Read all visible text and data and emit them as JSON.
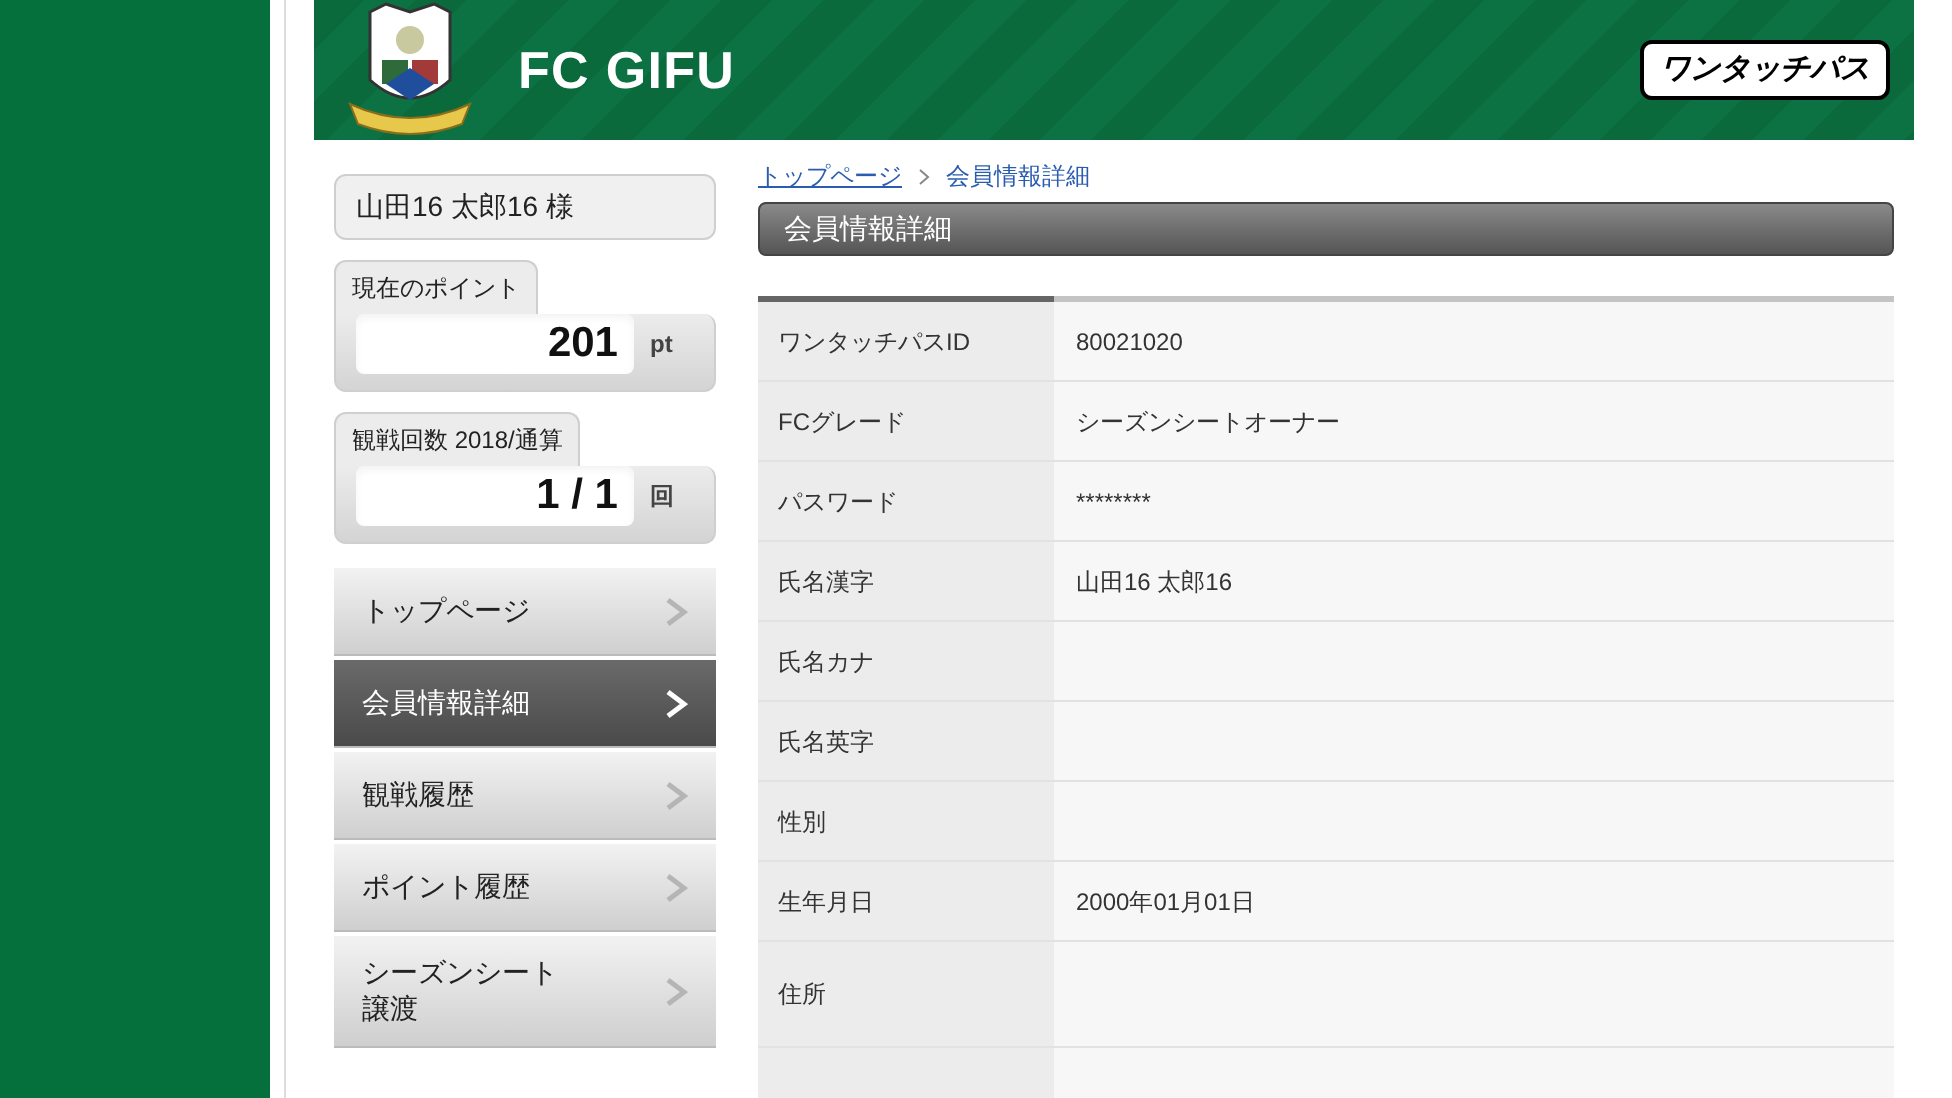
{
  "header": {
    "club_name": "FC GIFU",
    "service_logo": "ワンタッチパス"
  },
  "sidebar": {
    "user_name": "山田16 太郎16 様",
    "points": {
      "label": "現在のポイント",
      "value": "201",
      "unit": "pt"
    },
    "attendance": {
      "label": "観戦回数 2018/通算",
      "value": "1 / 1",
      "unit": "回"
    },
    "menu": [
      {
        "label": "トップページ",
        "selected": false
      },
      {
        "label": "会員情報詳細",
        "selected": true
      },
      {
        "label": "観戦履歴",
        "selected": false
      },
      {
        "label": "ポイント履歴",
        "selected": false
      },
      {
        "label": "シーズンシート譲渡",
        "selected": false
      }
    ]
  },
  "breadcrumb": [
    {
      "label": "トップページ",
      "kind": "link"
    },
    {
      "label": "会員情報詳細",
      "kind": "current"
    }
  ],
  "page_title": "会員情報詳細",
  "table": {
    "rows": [
      {
        "label": "ワンタッチパスID",
        "value": "80021020"
      },
      {
        "label": "FCグレード",
        "value": "シーズンシートオーナー"
      },
      {
        "label": "パスワード",
        "value": "********"
      },
      {
        "label": "氏名漢字",
        "value": "山田16 太郎16"
      },
      {
        "label": "氏名カナ",
        "value": ""
      },
      {
        "label": "氏名英字",
        "value": ""
      },
      {
        "label": "性別",
        "value": ""
      },
      {
        "label": "生年月日",
        "value": "2000年01月01日"
      },
      {
        "label": "住所",
        "value": ""
      }
    ]
  }
}
